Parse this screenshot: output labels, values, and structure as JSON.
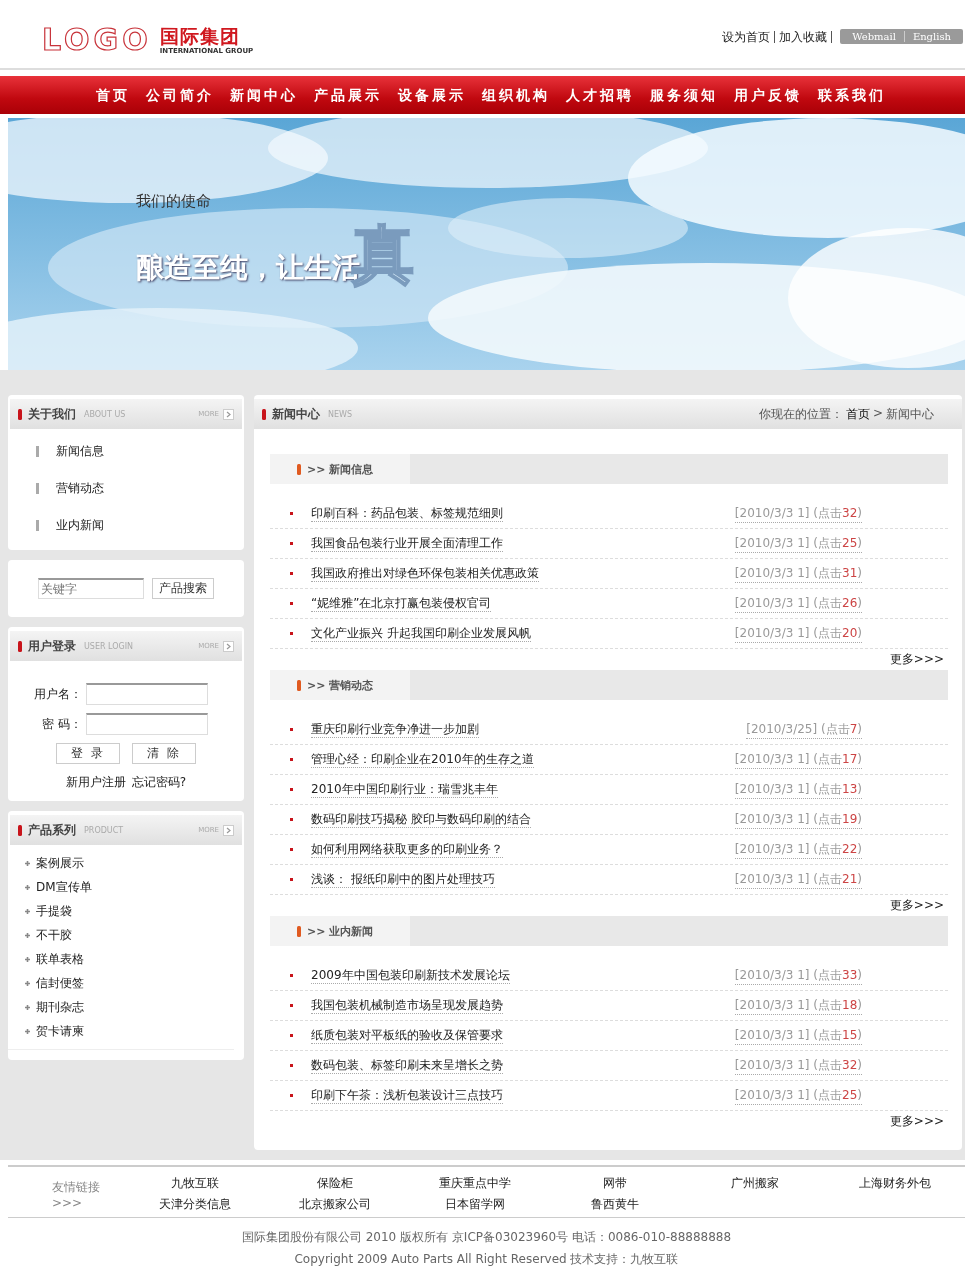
{
  "header": {
    "logo_mark": "LOGO",
    "logo_cn": "国际集团",
    "logo_en": "INTERNATIONAL GROUP",
    "top_links": [
      "设为首页",
      "加入收藏"
    ],
    "lang_links": [
      "Webmail",
      "English"
    ]
  },
  "nav": [
    "首页",
    "公司简介",
    "新闻中心",
    "产品展示",
    "设备展示",
    "组织机构",
    "人才招聘",
    "服务须知",
    "用户反馈",
    "联系我们"
  ],
  "banner": {
    "kind": "picture",
    "subtitle": "我们的使命",
    "slogan": "酿造至纯，让生活",
    "big_char": "真"
  },
  "sidebar": {
    "about": {
      "title": "关于我们",
      "subtitle": "ABOUT US",
      "more": "MORE",
      "items": [
        "新闻信息",
        "营销动态",
        "业内新闻"
      ]
    },
    "search": {
      "placeholder": "关键字",
      "button": "产品搜索"
    },
    "login": {
      "title": "用户登录",
      "subtitle": "USER LOGIN",
      "more": "MORE",
      "fields": [
        "用户名：",
        "密 码："
      ],
      "buttons": [
        "登 录",
        "清 除"
      ],
      "links": [
        "新用户注册",
        "忘记密码?"
      ]
    },
    "products": {
      "title": "产品系列",
      "subtitle": "PRODUCT",
      "more": "MORE",
      "items": [
        "案例展示",
        "DM宣传单",
        "手提袋",
        "不干胶",
        "联单表格",
        "信封便签",
        "期刊杂志",
        "贺卡请柬"
      ]
    }
  },
  "main": {
    "title": "新闻中心",
    "subtitle": "NEWS",
    "breadcrumb_label": "你现在的位置：",
    "breadcrumb": [
      "首页",
      "新闻中心"
    ],
    "separator": ">",
    "sections": [
      {
        "title": ">> 新闻信息",
        "more": "更多>>>",
        "items": [
          {
            "title": "印刷百科：药品包装、标签规范细则",
            "date": "[2010/3/3 1]",
            "clicks_label": "(点击",
            "clicks": "32",
            "clicks_end": ")"
          },
          {
            "title": "我国食品包装行业开展全面清理工作",
            "date": "[2010/3/3 1]",
            "clicks_label": "(点击",
            "clicks": "25",
            "clicks_end": ")"
          },
          {
            "title": "我国政府推出对绿色环保包装相关优惠政策",
            "date": "[2010/3/3 1]",
            "clicks_label": "(点击",
            "clicks": "31",
            "clicks_end": ")"
          },
          {
            "title": "“妮维雅”在北京打赢包装侵权官司",
            "date": "[2010/3/3 1]",
            "clicks_label": "(点击",
            "clicks": "26",
            "clicks_end": ")"
          },
          {
            "title": "文化产业振兴 升起我国印刷企业发展风帆",
            "date": "[2010/3/3 1]",
            "clicks_label": "(点击",
            "clicks": "20",
            "clicks_end": ")"
          }
        ]
      },
      {
        "title": ">> 营销动态",
        "more": "更多>>>",
        "items": [
          {
            "title": "重庆印刷行业竞争净进一步加剧",
            "date": "[2010/3/25]",
            "clicks_label": "(点击",
            "clicks": "7",
            "clicks_end": ")"
          },
          {
            "title": "管理心经：印刷企业在2010年的生存之道",
            "date": "[2010/3/3 1]",
            "clicks_label": "(点击",
            "clicks": "17",
            "clicks_end": ")"
          },
          {
            "title": "2010年中国印刷行业：瑞雪兆丰年",
            "date": "[2010/3/3 1]",
            "clicks_label": "(点击",
            "clicks": "13",
            "clicks_end": ")"
          },
          {
            "title": "数码印刷技巧揭秘 胶印与数码印刷的结合",
            "date": "[2010/3/3 1]",
            "clicks_label": "(点击",
            "clicks": "19",
            "clicks_end": ")"
          },
          {
            "title": "如何利用网络获取更多的印刷业务？",
            "date": "[2010/3/3 1]",
            "clicks_label": "(点击",
            "clicks": "22",
            "clicks_end": ")"
          },
          {
            "title": "浅谈： 报纸印刷中的图片处理技巧",
            "date": "[2010/3/3 1]",
            "clicks_label": "(点击",
            "clicks": "21",
            "clicks_end": ")"
          }
        ]
      },
      {
        "title": ">> 业内新闻",
        "more": "更多>>>",
        "items": [
          {
            "title": "2009年中国包装印刷新技术发展论坛",
            "date": "[2010/3/3 1]",
            "clicks_label": "(点击",
            "clicks": "33",
            "clicks_end": ")"
          },
          {
            "title": "我国包装机械制造市场呈现发展趋势",
            "date": "[2010/3/3 1]",
            "clicks_label": "(点击",
            "clicks": "18",
            "clicks_end": ")"
          },
          {
            "title": "纸质包装对平板纸的验收及保管要求",
            "date": "[2010/3/3 1]",
            "clicks_label": "(点击",
            "clicks": "15",
            "clicks_end": ")"
          },
          {
            "title": "数码包装、标签印刷未来呈增长之势",
            "date": "[2010/3/3 1]",
            "clicks_label": "(点击",
            "clicks": "32",
            "clicks_end": ")"
          },
          {
            "title": "印刷下午茶：浅析包装设计三点技巧",
            "date": "[2010/3/3 1]",
            "clicks_label": "(点击",
            "clicks": "25",
            "clicks_end": ")"
          }
        ]
      }
    ]
  },
  "footer": {
    "links_label": "友情链接>>>",
    "links": [
      "九牧互联",
      "保险柜",
      "重庆重点中学",
      "网带",
      "广州搬家",
      "上海财务外包",
      "天津分类信息",
      "北京搬家公司",
      "日本留学网",
      "鲁西黄牛"
    ],
    "copyright": [
      "国际集团股份有限公司 2010 版权所有 京ICP备03023960号 电话：0086-010-88888888",
      "Copyright 2009 Auto Parts All Right Reserved 技术支持：九牧互联"
    ]
  }
}
